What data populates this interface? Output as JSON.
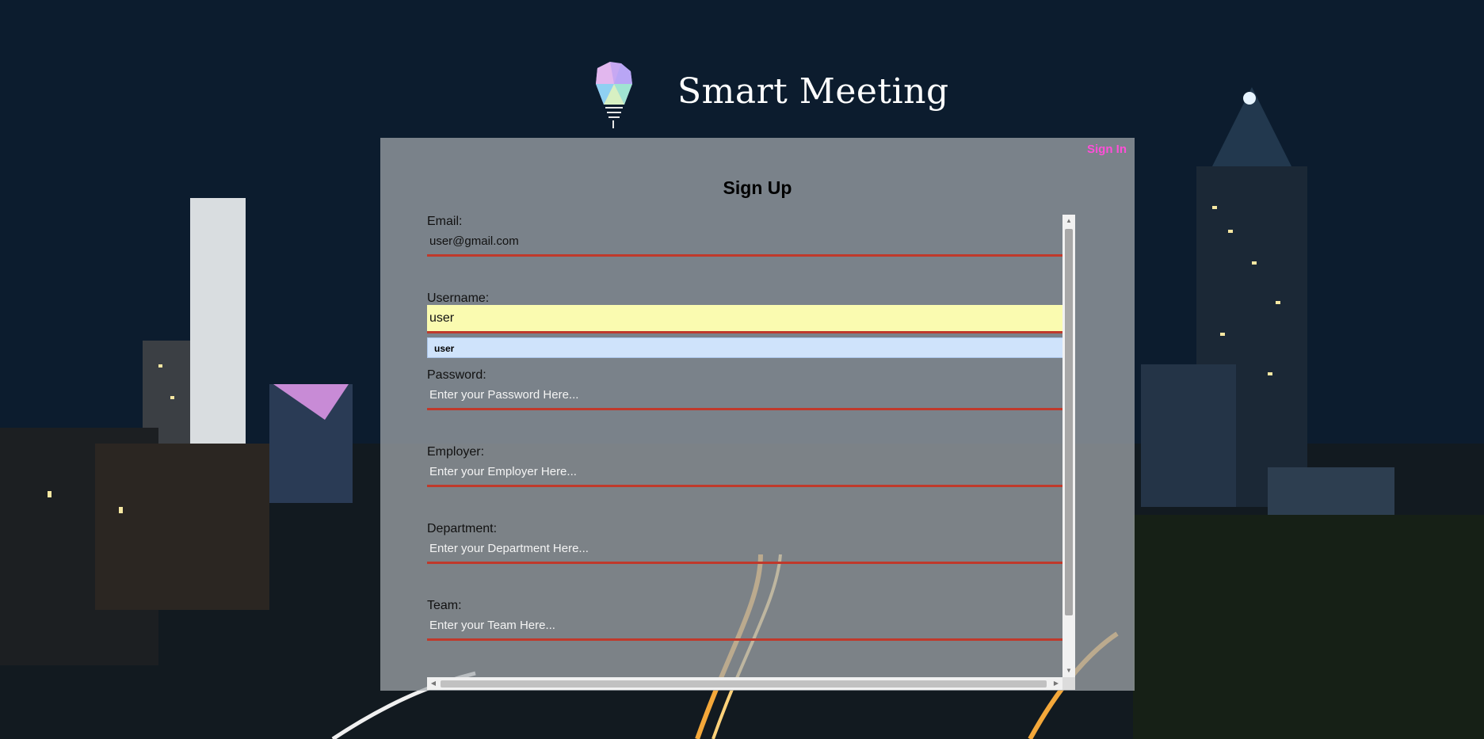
{
  "brand": {
    "title": "Smart Meeting"
  },
  "nav": {
    "signin_label": "Sign In"
  },
  "form": {
    "title": "Sign Up",
    "fields": [
      {
        "label": "Email:",
        "value": "user@gmail.com",
        "placeholder": ""
      },
      {
        "label": "Username:",
        "value": "user",
        "placeholder": ""
      },
      {
        "label": "Password:",
        "value": "",
        "placeholder": "Enter your Password Here..."
      },
      {
        "label": "Employer:",
        "value": "",
        "placeholder": "Enter your Employer Here..."
      },
      {
        "label": "Department:",
        "value": "",
        "placeholder": "Enter your Department Here..."
      },
      {
        "label": "Team:",
        "value": "",
        "placeholder": "Enter your Team Here..."
      }
    ],
    "autocomplete_suggestion": "user"
  },
  "colors": {
    "accent": "#ff4fd8",
    "underline": "#c0392b",
    "autofill": "#fafbb0"
  },
  "icons": {
    "logo": "lightbulb-gem-icon"
  }
}
